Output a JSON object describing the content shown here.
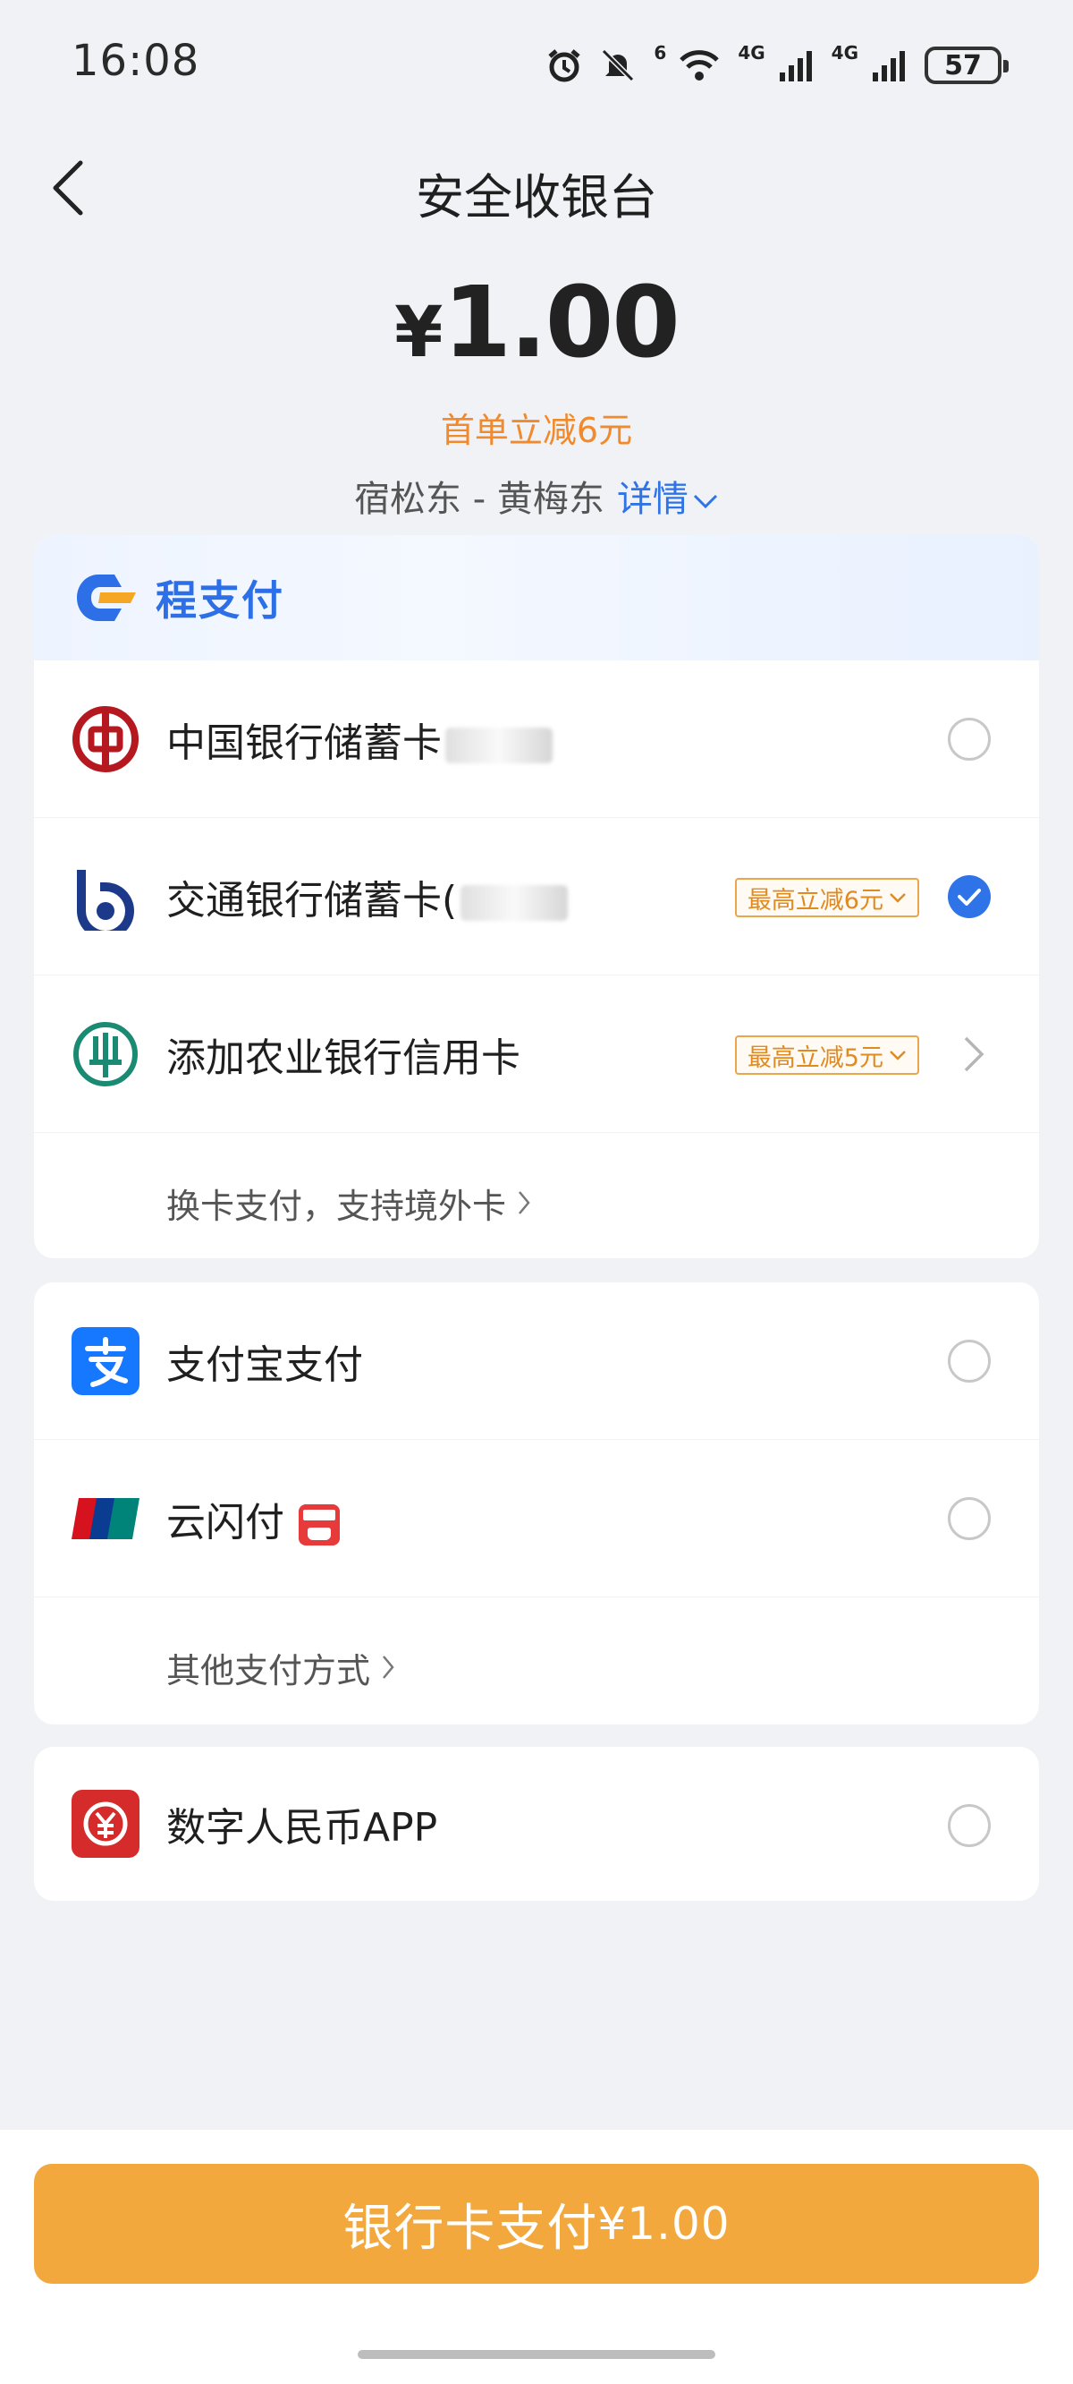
{
  "status_bar": {
    "time": "16:08",
    "network_1": "4G",
    "network_2": "4G",
    "wifi_tag": "6",
    "battery": "57"
  },
  "header": {
    "title": "安全收银台"
  },
  "order": {
    "currency": "¥",
    "amount": "1.00",
    "discount_note": "首单立减6元",
    "route": "宿松东 - 黄梅东",
    "details_label": "详情"
  },
  "cheng_pay": {
    "brand_name": "程支付",
    "banks": [
      {
        "name": "中国银行储蓄卡",
        "icon": "boc-icon",
        "selected": false
      },
      {
        "name": "交通银行储蓄卡(",
        "icon": "bocom-icon",
        "promo": "最高立减6元",
        "selected": true
      },
      {
        "name": "添加农业银行信用卡",
        "icon": "abc-icon",
        "promo": "最高立减5元"
      }
    ],
    "switch_card_label": "换卡支付，支持境外卡"
  },
  "other_methods": {
    "alipay_label": "支付宝支付",
    "unionpay_label": "云闪付",
    "more_label": "其他支付方式"
  },
  "ecny": {
    "label": "数字人民币APP"
  },
  "pay_button": {
    "label": "银行卡支付",
    "currency": "¥",
    "amount": "1.00"
  },
  "colors": {
    "accent": "#2f73e8",
    "orange": "#f2a83c",
    "discount": "#f08a2c"
  }
}
